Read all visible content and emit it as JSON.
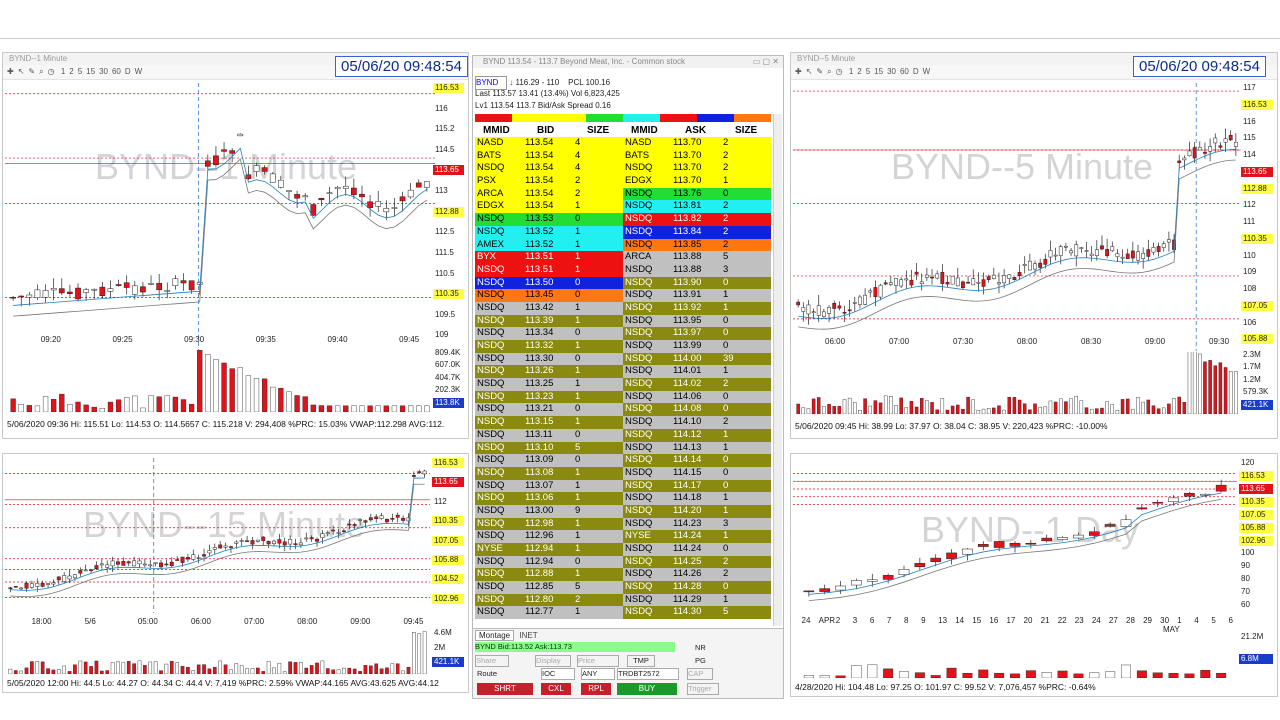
{
  "colors": {
    "up": "#ffffff",
    "down": "#e0121a",
    "ma_blue": "#1f7ec0",
    "ma_gray": "#777777",
    "res": "#e0121a",
    "vol": "#e0121a"
  },
  "charts": [
    {
      "key": "c1",
      "title": "BYND--1 Minute",
      "watermark": "BYND--1 Minute",
      "timestamp": "05/06/20 09:48:54",
      "toolbar": [
        "1",
        "2",
        "5",
        "15",
        "30",
        "60",
        "D",
        "W"
      ],
      "price_tags": [
        {
          "label": "116.53",
          "kind": "yellow"
        },
        {
          "label": "116",
          "kind": "plain"
        },
        {
          "label": "115.2",
          "kind": "plain"
        },
        {
          "label": "114.5",
          "kind": "plain"
        },
        {
          "label": "113.65",
          "kind": "red"
        },
        {
          "label": "113",
          "kind": "plain"
        },
        {
          "label": "112.88",
          "kind": "yellow"
        },
        {
          "label": "112.5",
          "kind": "plain"
        },
        {
          "label": "111.5",
          "kind": "plain"
        },
        {
          "label": "110.5",
          "kind": "plain"
        },
        {
          "label": "110.35",
          "kind": "yellow"
        },
        {
          "label": "109.5",
          "kind": "plain"
        },
        {
          "label": "109",
          "kind": "plain"
        }
      ],
      "time_ticks": [
        "09:20",
        "09:25",
        "09:30",
        "09:35",
        "09:40",
        "09:45"
      ],
      "cursor_time": "09:36",
      "vol_tags": [
        "809.4K",
        "607.0K",
        "404.7K",
        "202.3K",
        "113.8K"
      ],
      "status": "5/06/2020 09:36  Hi: 115.51  Lo: 114.53  O: 114.5657  C: 115.218  V: 294,408 %PRC: 15.03% VWAP:112.298 AVG:112."
    },
    {
      "key": "c2",
      "title": "BYND--5 Minute",
      "watermark": "BYND--5 Minute",
      "timestamp": "05/06/20 09:48:54",
      "toolbar": [
        "1",
        "2",
        "5",
        "15",
        "30",
        "60",
        "D",
        "W"
      ],
      "price_tags": [
        {
          "label": "117",
          "kind": "plain"
        },
        {
          "label": "116.53",
          "kind": "yellow"
        },
        {
          "label": "116",
          "kind": "plain"
        },
        {
          "label": "115",
          "kind": "plain"
        },
        {
          "label": "114",
          "kind": "plain"
        },
        {
          "label": "113.65",
          "kind": "red"
        },
        {
          "label": "112.88",
          "kind": "yellow"
        },
        {
          "label": "112",
          "kind": "plain"
        },
        {
          "label": "111",
          "kind": "plain"
        },
        {
          "label": "110.35",
          "kind": "yellow"
        },
        {
          "label": "110",
          "kind": "plain"
        },
        {
          "label": "109",
          "kind": "plain"
        },
        {
          "label": "108",
          "kind": "plain"
        },
        {
          "label": "107.05",
          "kind": "yellow"
        },
        {
          "label": "106",
          "kind": "plain"
        },
        {
          "label": "105.88",
          "kind": "yellow"
        }
      ],
      "time_ticks": [
        "06:00",
        "07:00",
        "07:30",
        "08:00",
        "08:30",
        "09:00",
        "09:30"
      ],
      "vol_tags": [
        "2.3M",
        "1.7M",
        "1.2M",
        "579.3K",
        "421.1K"
      ],
      "status": "5/06/2020 09:45  Hi: 38.99  Lo: 37.97  O: 38.04  C: 38.95  V: 220,423 %PRC: -10.00%"
    },
    {
      "key": "c3",
      "title": "BYND--15 Minute",
      "watermark": "BYND--15 Minute",
      "price_tags": [
        {
          "label": "116.53",
          "kind": "yellow"
        },
        {
          "label": "113.65",
          "kind": "red"
        },
        {
          "label": "112",
          "kind": "plain"
        },
        {
          "label": "110.35",
          "kind": "yellow"
        },
        {
          "label": "107.05",
          "kind": "yellow"
        },
        {
          "label": "105.88",
          "kind": "yellow"
        },
        {
          "label": "104.52",
          "kind": "yellow"
        },
        {
          "label": "102.96",
          "kind": "yellow"
        }
      ],
      "time_ticks": [
        "18:00",
        "5/6",
        "05:00",
        "06:00",
        "07:00",
        "08:00",
        "09:00",
        "09:45"
      ],
      "vol_tags": [
        "4.6M",
        "2M",
        "421.1K"
      ],
      "status": "5/05/2020 12:00  Hi: 44.5  Lo: 44.27  O: 44.34  C: 44.4  V: 7,419 %PRC: 2.59% VWAP:44.165 AVG:43.625 AVG:44.12"
    },
    {
      "key": "c4",
      "title": "BYND--1 Day",
      "watermark": "BYND--1 Day",
      "price_tags": [
        {
          "label": "120",
          "kind": "plain"
        },
        {
          "label": "116.53",
          "kind": "yellow"
        },
        {
          "label": "113.65",
          "kind": "red"
        },
        {
          "label": "110.35",
          "kind": "yellow"
        },
        {
          "label": "107.05",
          "kind": "yellow"
        },
        {
          "label": "105.88",
          "kind": "yellow"
        },
        {
          "label": "102.96",
          "kind": "yellow"
        },
        {
          "label": "100",
          "kind": "plain"
        },
        {
          "label": "90",
          "kind": "plain"
        },
        {
          "label": "80",
          "kind": "plain"
        },
        {
          "label": "70",
          "kind": "plain"
        },
        {
          "label": "60",
          "kind": "plain"
        }
      ],
      "time_ticks": [
        "24",
        "APR",
        "2",
        "3",
        "6",
        "7",
        "8",
        "9",
        "13",
        "14",
        "15",
        "16",
        "17",
        "20",
        "21",
        "22",
        "23",
        "24",
        "27",
        "28",
        "29",
        "30",
        "1",
        "4",
        "5",
        "6"
      ],
      "month_label": "MAY",
      "vol_tags": [
        "21.2M",
        "6.8M"
      ],
      "status": "4/28/2020  Hi: 104.48  Lo: 97.25  O: 101.97  C: 99.52  V: 7,076,457 %PRC: -0.64%"
    }
  ],
  "level2": {
    "title": "BYND    113.54 - 113.7    Beyond Meat, Inc. - Common stock",
    "symbol": "BYND",
    "range": "116.29 - 110",
    "pcl": "PCL 100.16",
    "last": "Last  113.57     13.41  (13.4%)      Vol  6,823,425",
    "lv1": "Lv1   113.54     113.7          Bid/Ask Spread  0.16",
    "bid_headers": [
      "MMID",
      "BID",
      "SIZE"
    ],
    "ask_headers": [
      "MMID",
      "ASK",
      "SIZE"
    ],
    "bids": [
      [
        "NASD",
        "113.54",
        "4",
        "#ffff00"
      ],
      [
        "BATS",
        "113.54",
        "4",
        "#ffff00"
      ],
      [
        "NSDQ",
        "113.54",
        "4",
        "#ffff00"
      ],
      [
        "PSX",
        "113.54",
        "2",
        "#ffff00"
      ],
      [
        "ARCA",
        "113.54",
        "2",
        "#ffff00"
      ],
      [
        "EDGX",
        "113.54",
        "1",
        "#ffff00"
      ],
      [
        "NSDQ",
        "113.53",
        "0",
        "#22dd33"
      ],
      [
        "NSDQ",
        "113.52",
        "1",
        "#22f0f0"
      ],
      [
        "AMEX",
        "113.52",
        "1",
        "#22f0f0"
      ],
      [
        "BYX",
        "113.51",
        "1",
        "#ee1111"
      ],
      [
        "NSDQ",
        "113.51",
        "1",
        "#ee1111"
      ],
      [
        "NSDQ",
        "113.50",
        "0",
        "#1122dd"
      ],
      [
        "NSDQ",
        "113.45",
        "0",
        "#ff7711"
      ],
      [
        "NSDQ",
        "113.42",
        "1",
        "#c0c0c0"
      ],
      [
        "NSDQ",
        "113.39",
        "1",
        "#8a8a10"
      ],
      [
        "NSDQ",
        "113.34",
        "0",
        "#c0c0c0"
      ],
      [
        "NSDQ",
        "113.32",
        "1",
        "#8a8a10"
      ],
      [
        "NSDQ",
        "113.30",
        "0",
        "#c0c0c0"
      ],
      [
        "NSDQ",
        "113.26",
        "1",
        "#8a8a10"
      ],
      [
        "NSDQ",
        "113.25",
        "1",
        "#c0c0c0"
      ],
      [
        "NSDQ",
        "113.23",
        "1",
        "#8a8a10"
      ],
      [
        "NSDQ",
        "113.21",
        "0",
        "#c0c0c0"
      ],
      [
        "NSDQ",
        "113.15",
        "1",
        "#8a8a10"
      ],
      [
        "NSDQ",
        "113.11",
        "0",
        "#c0c0c0"
      ],
      [
        "NSDQ",
        "113.10",
        "5",
        "#8a8a10"
      ],
      [
        "NSDQ",
        "113.09",
        "0",
        "#c0c0c0"
      ],
      [
        "NSDQ",
        "113.08",
        "1",
        "#8a8a10"
      ],
      [
        "NSDQ",
        "113.07",
        "1",
        "#c0c0c0"
      ],
      [
        "NSDQ",
        "113.06",
        "1",
        "#8a8a10"
      ],
      [
        "NSDQ",
        "113.00",
        "9",
        "#c0c0c0"
      ],
      [
        "NSDQ",
        "112.98",
        "1",
        "#8a8a10"
      ],
      [
        "NSDQ",
        "112.96",
        "1",
        "#c0c0c0"
      ],
      [
        "NYSE",
        "112.94",
        "1",
        "#8a8a10"
      ],
      [
        "NSDQ",
        "112.94",
        "0",
        "#c0c0c0"
      ],
      [
        "NSDQ",
        "112.88",
        "1",
        "#8a8a10"
      ],
      [
        "NSDQ",
        "112.85",
        "5",
        "#c0c0c0"
      ],
      [
        "NSDQ",
        "112.80",
        "2",
        "#8a8a10"
      ],
      [
        "NSDQ",
        "112.77",
        "1",
        "#c0c0c0"
      ]
    ],
    "asks": [
      [
        "NASD",
        "113.70",
        "2",
        "#ffff00"
      ],
      [
        "BATS",
        "113.70",
        "2",
        "#ffff00"
      ],
      [
        "NSDQ",
        "113.70",
        "2",
        "#ffff00"
      ],
      [
        "EDGX",
        "113.70",
        "1",
        "#ffff00"
      ],
      [
        "NSDQ",
        "113.76",
        "0",
        "#22dd33"
      ],
      [
        "NSDQ",
        "113.81",
        "2",
        "#22f0f0"
      ],
      [
        "NSDQ",
        "113.82",
        "2",
        "#ee1111"
      ],
      [
        "NSDQ",
        "113.84",
        "2",
        "#1122dd"
      ],
      [
        "NSDQ",
        "113.85",
        "2",
        "#ff7711"
      ],
      [
        "ARCA",
        "113.88",
        "5",
        "#c0c0c0"
      ],
      [
        "NSDQ",
        "113.88",
        "3",
        "#c0c0c0"
      ],
      [
        "NSDQ",
        "113.90",
        "0",
        "#8a8a10"
      ],
      [
        "NSDQ",
        "113.91",
        "1",
        "#c0c0c0"
      ],
      [
        "NSDQ",
        "113.92",
        "1",
        "#8a8a10"
      ],
      [
        "NSDQ",
        "113.95",
        "0",
        "#c0c0c0"
      ],
      [
        "NSDQ",
        "113.97",
        "0",
        "#8a8a10"
      ],
      [
        "NSDQ",
        "113.99",
        "0",
        "#c0c0c0"
      ],
      [
        "NSDQ",
        "114.00",
        "39",
        "#8a8a10"
      ],
      [
        "NSDQ",
        "114.01",
        "1",
        "#c0c0c0"
      ],
      [
        "NSDQ",
        "114.02",
        "2",
        "#8a8a10"
      ],
      [
        "NSDQ",
        "114.06",
        "0",
        "#c0c0c0"
      ],
      [
        "NSDQ",
        "114.08",
        "0",
        "#8a8a10"
      ],
      [
        "NSDQ",
        "114.10",
        "2",
        "#c0c0c0"
      ],
      [
        "NSDQ",
        "114.12",
        "1",
        "#8a8a10"
      ],
      [
        "NSDQ",
        "114.13",
        "1",
        "#c0c0c0"
      ],
      [
        "NSDQ",
        "114.14",
        "0",
        "#8a8a10"
      ],
      [
        "NSDQ",
        "114.15",
        "0",
        "#c0c0c0"
      ],
      [
        "NSDQ",
        "114.17",
        "0",
        "#8a8a10"
      ],
      [
        "NSDQ",
        "114.18",
        "1",
        "#c0c0c0"
      ],
      [
        "NSDQ",
        "114.20",
        "1",
        "#8a8a10"
      ],
      [
        "NSDQ",
        "114.23",
        "3",
        "#c0c0c0"
      ],
      [
        "NYSE",
        "114.24",
        "1",
        "#8a8a10"
      ],
      [
        "NSDQ",
        "114.24",
        "0",
        "#c0c0c0"
      ],
      [
        "NSDQ",
        "114.25",
        "2",
        "#8a8a10"
      ],
      [
        "NSDQ",
        "114.26",
        "2",
        "#c0c0c0"
      ],
      [
        "NSDQ",
        "114.28",
        "0",
        "#8a8a10"
      ],
      [
        "NSDQ",
        "114.29",
        "1",
        "#c0c0c0"
      ],
      [
        "NSDQ",
        "114.30",
        "5",
        "#8a8a10"
      ]
    ],
    "order": {
      "tabs": [
        "Montage",
        "INET"
      ],
      "notice": "BYND Bid:113.52 Ask:113.73",
      "route_label": "Route",
      "dest": "IOC",
      "tif": "ANY",
      "account": "TRDBT2572",
      "share_label": "Share",
      "display_label": "Display",
      "price_label": "Price",
      "tmp_label": "TMP",
      "nr_label": "NR",
      "pg_label": "PG",
      "cap_label": "CAP",
      "trigger_label": "Trigger",
      "short_label": "SHRT",
      "cxl_label": "CXL",
      "rpl_label": "RPL",
      "buy_label": "BUY"
    }
  }
}
